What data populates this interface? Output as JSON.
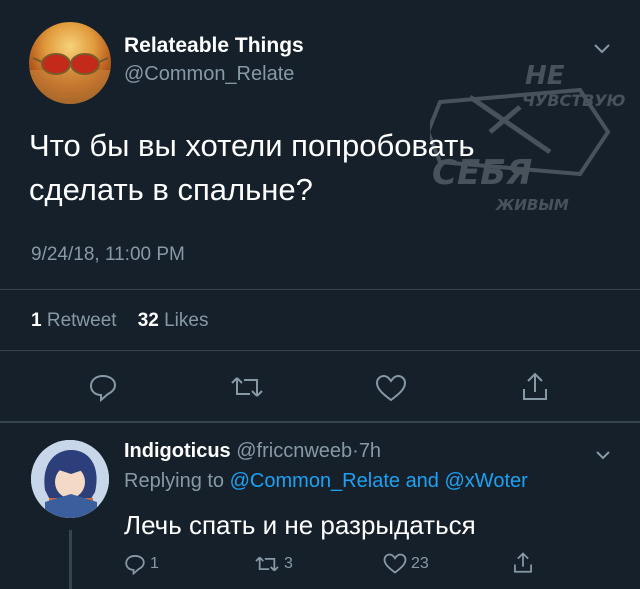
{
  "tweet": {
    "author_name": "Relateable Things",
    "author_handle": "@Common_Relate",
    "text": "Что бы вы хотели попробовать сделать в спальне?",
    "timestamp": "9/24/18, 11:00 PM",
    "retweet_count": "1",
    "retweet_label": "Retweet",
    "like_count": "32",
    "like_label": "Likes"
  },
  "watermark": {
    "line1": "НЕ",
    "line2": "ЧУВСТВУЮ",
    "line3": "СЕБЯ",
    "line4": "ЖИВЫМ"
  },
  "reply": {
    "author_name": "Indigoticus",
    "author_handle": "@friccnweeb",
    "separator": "·",
    "time": "7h",
    "replying_prefix": "Replying to",
    "replying_to_1": "@Common_Relate",
    "replying_and": "and",
    "replying_to_2": "@xWoter",
    "text": "Лечь спать и не разрыдаться",
    "reply_count": "1",
    "retweet_count": "3",
    "like_count": "23"
  },
  "icons": [
    "chevron-down-icon",
    "reply-icon",
    "retweet-icon",
    "like-icon",
    "share-icon"
  ],
  "colors": {
    "background": "#15202b",
    "secondary_text": "#8899a6",
    "link": "#1da1f2",
    "divider": "#38444d"
  }
}
